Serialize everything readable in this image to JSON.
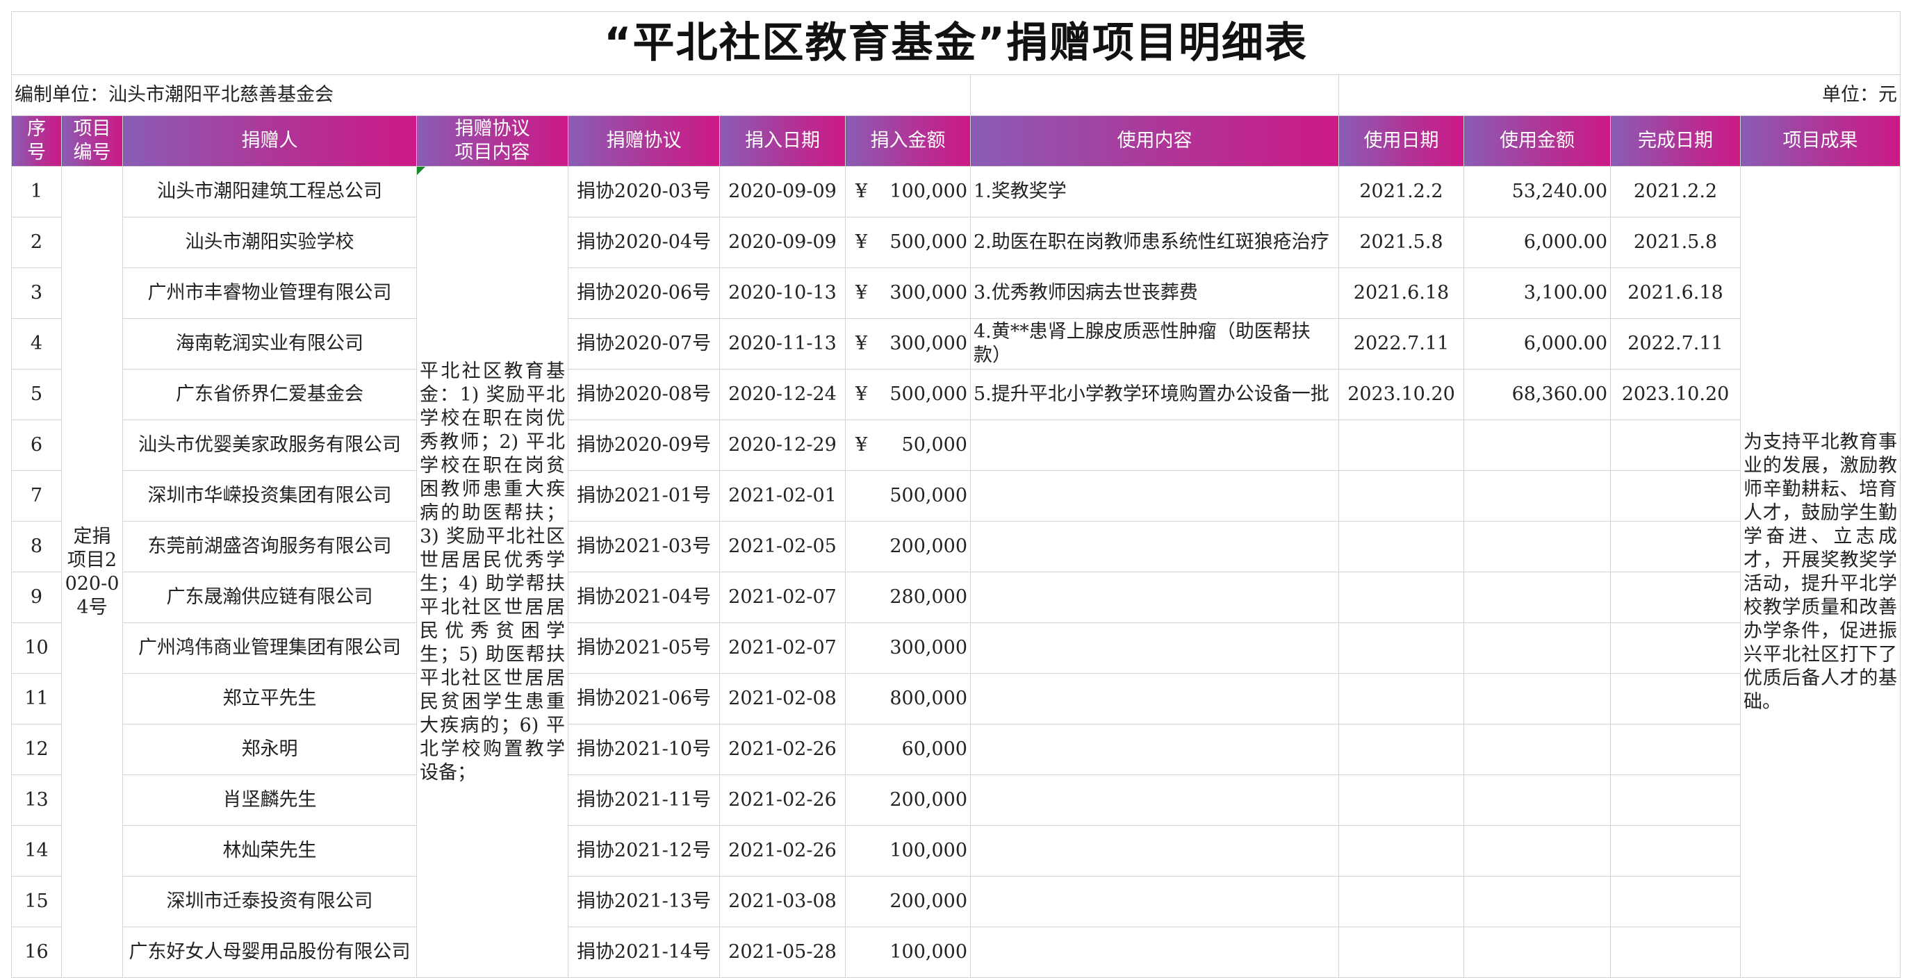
{
  "title": "“平北社区教育基金”捐赠项目明细表",
  "compiler": "编制单位：汕头市潮阳平北慈善基金会",
  "unit": "单位：元",
  "headers": {
    "seq": "序号",
    "project_no": "项目编号",
    "donor": "捐赠人",
    "agreement_content": "捐赠协议项目内容",
    "agreement": "捐赠协议",
    "in_date": "捐入日期",
    "in_amount": "捐入金额",
    "use_content": "使用内容",
    "use_date": "使用日期",
    "use_amount": "使用金额",
    "done_date": "完成日期",
    "result": "项目成果"
  },
  "project_no_value": "定捐项目2020-04号",
  "agreement_content_value": "平北社区教育基金：1) 奖励平北学校在职在岗优秀教师；2) 平北学校在职在岗贫困教师患重大疾病的助医帮扶；3) 奖励平北社区世居居民优秀学生；4) 助学帮扶平北社区世居居民优秀贫困学生；5) 助医帮扶平北社区世居居民贫困学生患重大疾病的；6) 平北学校购置教学设备；",
  "result_value": "为支持平北教育事业的发展，激励教师辛勤耕耘、培育人才，鼓励学生勤学奋进、立志成才，开展奖教奖学活动，提升平北学校教学质量和改善办学条件，促进振兴平北社区打下了优质后备人才的基础。",
  "rows": [
    {
      "seq": "1",
      "donor": "汕头市潮阳建筑工程总公司",
      "agreement": "捐协2020-03号",
      "in_date": "2020-09-09",
      "yen": "¥",
      "amount": "100,000",
      "use_content": "1.奖教奖学",
      "use_date": "2021.2.2",
      "use_amount": "53,240.00",
      "done_date": "2021.2.2"
    },
    {
      "seq": "2",
      "donor": "汕头市潮阳实验学校",
      "agreement": "捐协2020-04号",
      "in_date": "2020-09-09",
      "yen": "¥",
      "amount": "500,000",
      "use_content": "2.助医在职在岗教师患系统性红斑狼疮治疗",
      "use_date": "2021.5.8",
      "use_amount": "6,000.00",
      "done_date": "2021.5.8"
    },
    {
      "seq": "3",
      "donor": "广州市丰睿物业管理有限公司",
      "agreement": "捐协2020-06号",
      "in_date": "2020-10-13",
      "yen": "¥",
      "amount": "300,000",
      "use_content": "3.优秀教师因病去世丧葬费",
      "use_date": "2021.6.18",
      "use_amount": "3,100.00",
      "done_date": "2021.6.18"
    },
    {
      "seq": "4",
      "donor": "海南乾润实业有限公司",
      "agreement": "捐协2020-07号",
      "in_date": "2020-11-13",
      "yen": "¥",
      "amount": "300,000",
      "use_content": "4.黄**患肾上腺皮质恶性肿瘤（助医帮扶款）",
      "use_date": "2022.7.11",
      "use_amount": "6,000.00",
      "done_date": "2022.7.11"
    },
    {
      "seq": "5",
      "donor": "广东省侨界仁爱基金会",
      "agreement": "捐协2020-08号",
      "in_date": "2020-12-24",
      "yen": "¥",
      "amount": "500,000",
      "use_content": "5.提升平北小学教学环境购置办公设备一批",
      "use_date": "2023.10.20",
      "use_amount": "68,360.00",
      "done_date": "2023.10.20"
    },
    {
      "seq": "6",
      "donor": "汕头市优婴美家政服务有限公司",
      "agreement": "捐协2020-09号",
      "in_date": "2020-12-29",
      "yen": "¥",
      "amount": "50,000",
      "use_content": "",
      "use_date": "",
      "use_amount": "",
      "done_date": ""
    },
    {
      "seq": "7",
      "donor": "深圳市华嵘投资集团有限公司",
      "agreement": "捐协2021-01号",
      "in_date": "2021-02-01",
      "yen": "",
      "amount": "500,000",
      "use_content": "",
      "use_date": "",
      "use_amount": "",
      "done_date": ""
    },
    {
      "seq": "8",
      "donor": "东莞前湖盛咨询服务有限公司",
      "agreement": "捐协2021-03号",
      "in_date": "2021-02-05",
      "yen": "",
      "amount": "200,000",
      "use_content": "",
      "use_date": "",
      "use_amount": "",
      "done_date": ""
    },
    {
      "seq": "9",
      "donor": "广东晟瀚供应链有限公司",
      "agreement": "捐协2021-04号",
      "in_date": "2021-02-07",
      "yen": "",
      "amount": "280,000",
      "use_content": "",
      "use_date": "",
      "use_amount": "",
      "done_date": ""
    },
    {
      "seq": "10",
      "donor": "广州鸿伟商业管理集团有限公司",
      "agreement": "捐协2021-05号",
      "in_date": "2021-02-07",
      "yen": "",
      "amount": "300,000",
      "use_content": "",
      "use_date": "",
      "use_amount": "",
      "done_date": ""
    },
    {
      "seq": "11",
      "donor": "郑立平先生",
      "agreement": "捐协2021-06号",
      "in_date": "2021-02-08",
      "yen": "",
      "amount": "800,000",
      "use_content": "",
      "use_date": "",
      "use_amount": "",
      "done_date": ""
    },
    {
      "seq": "12",
      "donor": "郑永明",
      "agreement": "捐协2021-10号",
      "in_date": "2021-02-26",
      "yen": "",
      "amount": "60,000",
      "use_content": "",
      "use_date": "",
      "use_amount": "",
      "done_date": ""
    },
    {
      "seq": "13",
      "donor": "肖坚麟先生",
      "agreement": "捐协2021-11号",
      "in_date": "2021-02-26",
      "yen": "",
      "amount": "200,000",
      "use_content": "",
      "use_date": "",
      "use_amount": "",
      "done_date": ""
    },
    {
      "seq": "14",
      "donor": "林灿荣先生",
      "agreement": "捐协2021-12号",
      "in_date": "2021-02-26",
      "yen": "",
      "amount": "100,000",
      "use_content": "",
      "use_date": "",
      "use_amount": "",
      "done_date": ""
    },
    {
      "seq": "15",
      "donor": "深圳市迁泰投资有限公司",
      "agreement": "捐协2021-13号",
      "in_date": "2021-03-08",
      "yen": "",
      "amount": "200,000",
      "use_content": "",
      "use_date": "",
      "use_amount": "",
      "done_date": ""
    },
    {
      "seq": "16",
      "donor": "广东好女人母婴用品股份有限公司",
      "agreement": "捐协2021-14号",
      "in_date": "2021-05-28",
      "yen": "",
      "amount": "100,000",
      "use_content": "",
      "use_date": "",
      "use_amount": "",
      "done_date": ""
    }
  ]
}
